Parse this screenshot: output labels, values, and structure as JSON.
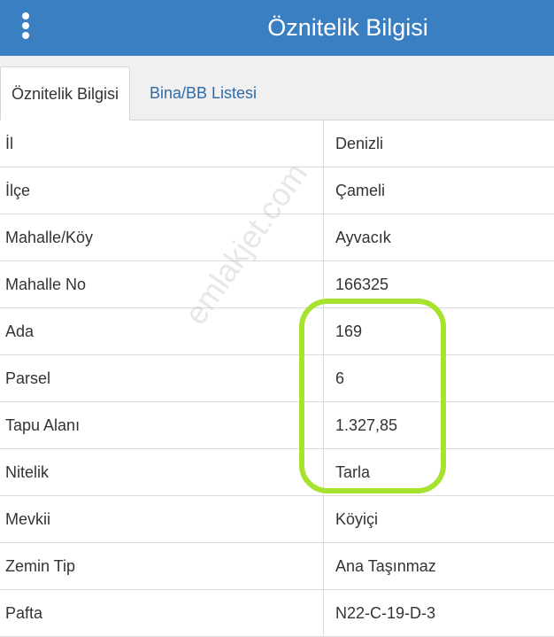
{
  "header": {
    "title": "Öznitelik Bilgisi"
  },
  "tabs": [
    {
      "label": "Öznitelik Bilgisi"
    },
    {
      "label": "Bina/BB Listesi"
    }
  ],
  "rows": [
    {
      "key": "İl",
      "value": "Denizli"
    },
    {
      "key": "İlçe",
      "value": "Çameli"
    },
    {
      "key": "Mahalle/Köy",
      "value": "Ayvacık"
    },
    {
      "key": "Mahalle No",
      "value": "166325"
    },
    {
      "key": "Ada",
      "value": "169"
    },
    {
      "key": "Parsel",
      "value": "6"
    },
    {
      "key": "Tapu Alanı",
      "value": "1.327,85"
    },
    {
      "key": "Nitelik",
      "value": "Tarla"
    },
    {
      "key": "Mevkii",
      "value": "Köyiçi"
    },
    {
      "key": "Zemin Tip",
      "value": "Ana Taşınmaz"
    },
    {
      "key": "Pafta",
      "value": "N22-C-19-D-3"
    }
  ],
  "watermark": "emlakjet.com",
  "colors": {
    "header": "#3a7fc2",
    "highlight": "#a6e22e",
    "tab_link": "#2f6aa6"
  }
}
